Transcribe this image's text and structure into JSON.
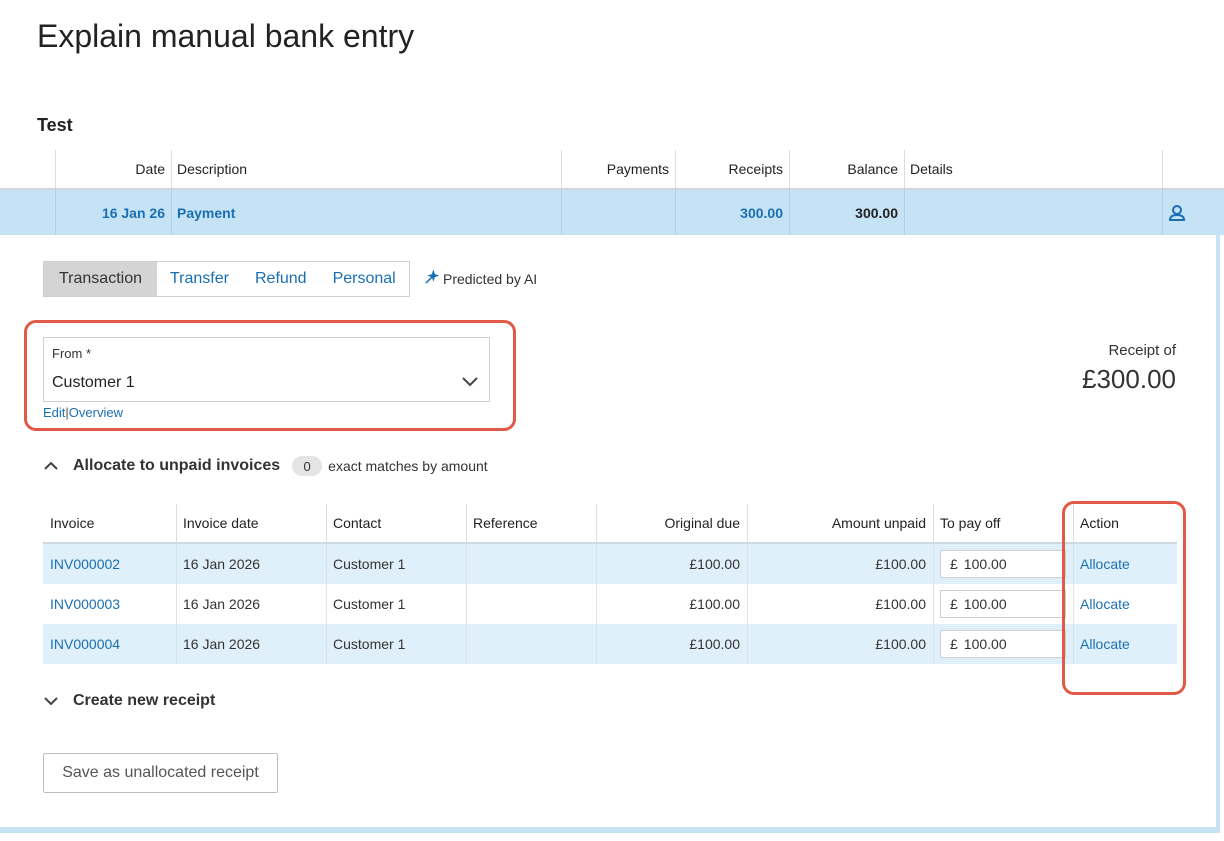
{
  "page": {
    "title": "Explain manual bank entry"
  },
  "account": {
    "name": "Test"
  },
  "bank_table": {
    "headers": {
      "date": "Date",
      "description": "Description",
      "payments": "Payments",
      "receipts": "Receipts",
      "balance": "Balance",
      "details": "Details"
    },
    "row": {
      "date": "16 Jan 26",
      "description": "Payment",
      "payments": "",
      "receipts": "300.00",
      "balance": "300.00",
      "details": "",
      "icon": "user-icon"
    }
  },
  "tabs": [
    {
      "label": "Transaction",
      "active": true
    },
    {
      "label": "Transfer",
      "active": false
    },
    {
      "label": "Refund",
      "active": false
    },
    {
      "label": "Personal",
      "active": false
    }
  ],
  "ai_note": {
    "icon": "magic-wand-icon",
    "text": "Predicted by AI"
  },
  "from_field": {
    "label": "From *",
    "value": "Customer 1",
    "edit_link": "Edit",
    "separator": "|",
    "overview_link": "Overview"
  },
  "receipt": {
    "label": "Receipt of",
    "amount": "£300.00"
  },
  "allocate_section": {
    "title": "Allocate to unpaid invoices",
    "match_count": "0",
    "match_text": "exact matches by amount",
    "expanded": true
  },
  "invoice_table": {
    "headers": {
      "invoice": "Invoice",
      "invoice_date": "Invoice date",
      "contact": "Contact",
      "reference": "Reference",
      "original_due": "Original due",
      "amount_unpaid": "Amount unpaid",
      "to_pay_off": "To pay off",
      "action": "Action"
    },
    "rows": [
      {
        "invoice": "INV000002",
        "invoice_date": "16 Jan 2026",
        "contact": "Customer 1",
        "reference": "",
        "original_due": "£100.00",
        "amount_unpaid": "£100.00",
        "currency": "£",
        "to_pay_off": "100.00",
        "action": "Allocate"
      },
      {
        "invoice": "INV000003",
        "invoice_date": "16 Jan 2026",
        "contact": "Customer 1",
        "reference": "",
        "original_due": "£100.00",
        "amount_unpaid": "£100.00",
        "currency": "£",
        "to_pay_off": "100.00",
        "action": "Allocate"
      },
      {
        "invoice": "INV000004",
        "invoice_date": "16 Jan 2026",
        "contact": "Customer 1",
        "reference": "",
        "original_due": "£100.00",
        "amount_unpaid": "£100.00",
        "currency": "£",
        "to_pay_off": "100.00",
        "action": "Allocate"
      }
    ]
  },
  "create_section": {
    "title": "Create new receipt",
    "expanded": false
  },
  "buttons": {
    "save_unallocated": "Save as unallocated receipt"
  },
  "colors": {
    "accent": "#1a6fb3",
    "highlight_row": "#c6e2f5",
    "annotation": "#e05a47"
  }
}
